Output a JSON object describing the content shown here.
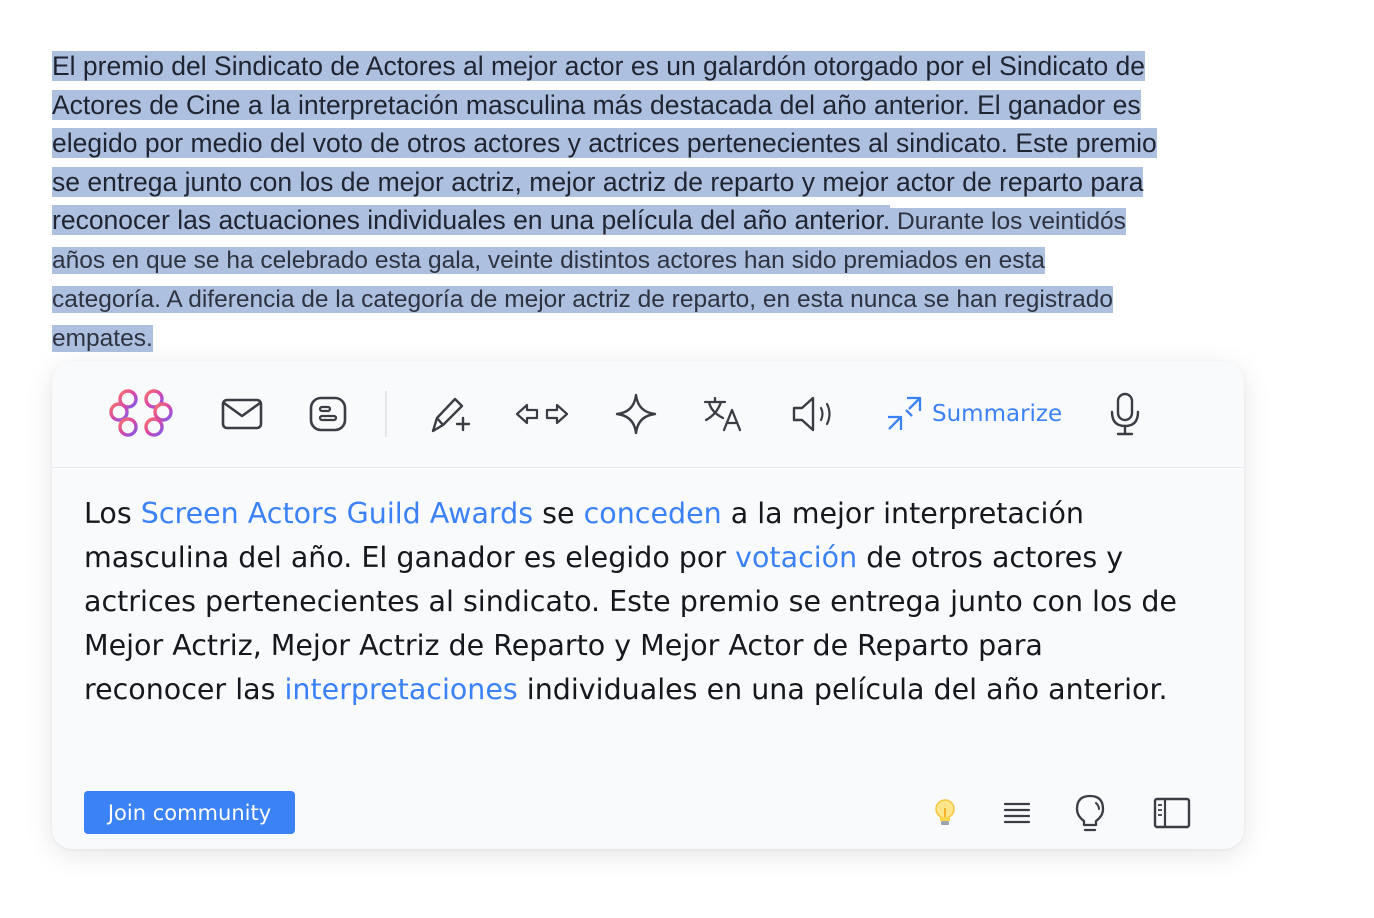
{
  "source_text": {
    "line1": "El premio del Sindicato de Actores al mejor actor es un galardón otorgado por el Sindicato de",
    "line2": "Actores de Cine a la interpretación masculina más destacada del año anterior. El ganador es",
    "line3": "elegido por medio del voto de otros actores y actrices pertenecientes al sindicato. Este premio",
    "line4": "se entrega junto con los de mejor actriz, mejor actriz de reparto y mejor actor de reparto para",
    "line5a": "reconocer las actuaciones individuales en una película del año anterior.",
    "line5b": " Durante los veintidós",
    "line6": "años en que se ha celebrado esta gala, veinte distintos actores han sido premiados en esta",
    "line7": "categoría. A diferencia de la categoría de mejor actriz de reparto, en esta nunca se han registrado",
    "line8": "empates."
  },
  "toolbar": {
    "summarize_label": "Summarize",
    "icons": [
      "brain-logo-icon",
      "mail-icon",
      "blogger-icon",
      "magic-pen-icon",
      "arrows-left-right-icon",
      "sparkle-icon",
      "translate-icon",
      "speaker-icon",
      "summarize-icon",
      "microphone-icon"
    ]
  },
  "summary": {
    "s1": "Los ",
    "l1": "Screen Actors Guild Awards",
    "s2": " se ",
    "l2": "conceden",
    "s3": " a la mejor interpretación masculina del año. El ganador es elegido por ",
    "l3": "votación",
    "s4": " de otros actores y actrices pertenecientes al sindicato. Este premio se entrega junto con los de Mejor Actriz, Mejor Actriz de Reparto y Mejor Actor de Reparto para reconocer las ",
    "l4": "interpretaciones",
    "s5": " individuales en una película del año anterior."
  },
  "footer": {
    "join_label": "Join community",
    "icons": [
      "bulb-emoji-icon",
      "align-text-icon",
      "lightbulb-outline-icon",
      "sidebar-panel-icon"
    ]
  },
  "colors": {
    "accent": "#3b82f6",
    "highlight": "#aec0e0",
    "panel_bg": "#f9fafc"
  }
}
